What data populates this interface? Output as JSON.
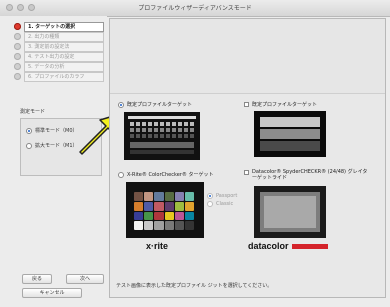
{
  "window": {
    "title": "プロファイルウィザーディアバンスモード"
  },
  "steps": [
    {
      "label": "1. ターゲットの選択",
      "active": true
    },
    {
      "label": "2. 出力の種類",
      "active": false
    },
    {
      "label": "3. 測定前の設定法",
      "active": false
    },
    {
      "label": "4. テスト出力の設定",
      "active": false
    },
    {
      "label": "5. データの分析",
      "active": false
    },
    {
      "label": "6. プロファイルのカラフ",
      "active": false
    }
  ],
  "measure_mode": {
    "header": "測定モード",
    "options": [
      "標準モード（M0）",
      "拡大モード（M1）"
    ],
    "selected": 0
  },
  "buttons": {
    "back": "戻る",
    "next": "次へ",
    "cancel": "キャンセル"
  },
  "targets": {
    "opt1": "既定プロファイルターゲット",
    "opt2": "既定プロファイルターゲット",
    "opt3": "X-Rite® ColorChecker® ターゲット",
    "opt4": "Datacolor® SpyderCHECKR® (24/48) グレイターゲットライド",
    "opt3_sub_a": "Passport",
    "opt3_sub_b": "Classic",
    "logo_xrite": "x·rite",
    "logo_datacolor": "datacolor"
  },
  "note": "テスト画像に表示した既定プロファイル ジットを選択してください。",
  "colors": {
    "active_step": "#e03a2e",
    "arrow": "#f2ef1f",
    "datacolor_bar": "#d4232a"
  }
}
